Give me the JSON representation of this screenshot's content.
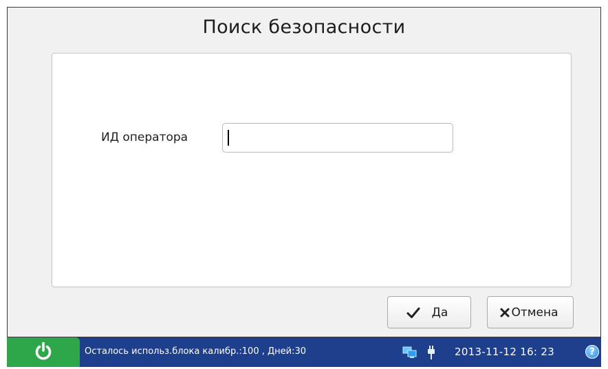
{
  "dialog": {
    "title": "Поиск безопасности",
    "field_label": "ИД оператора",
    "field_value": "",
    "ok_label": "Да",
    "cancel_label": "Отмена"
  },
  "status_bar": {
    "message": "Осталось использ.блока калибр.:100 , Дней:30",
    "datetime": "2013-11-12  16: 23",
    "help_symbol": "?",
    "icons": [
      "power-icon",
      "network-icon",
      "plug-icon",
      "help-icon"
    ]
  },
  "colors": {
    "status_bar": "#1d3f8c",
    "power_button": "#2ea64a",
    "dialog_bg": "#f1f1f1",
    "panel_bg": "#ffffff",
    "help_icon": "#2f8de4"
  }
}
